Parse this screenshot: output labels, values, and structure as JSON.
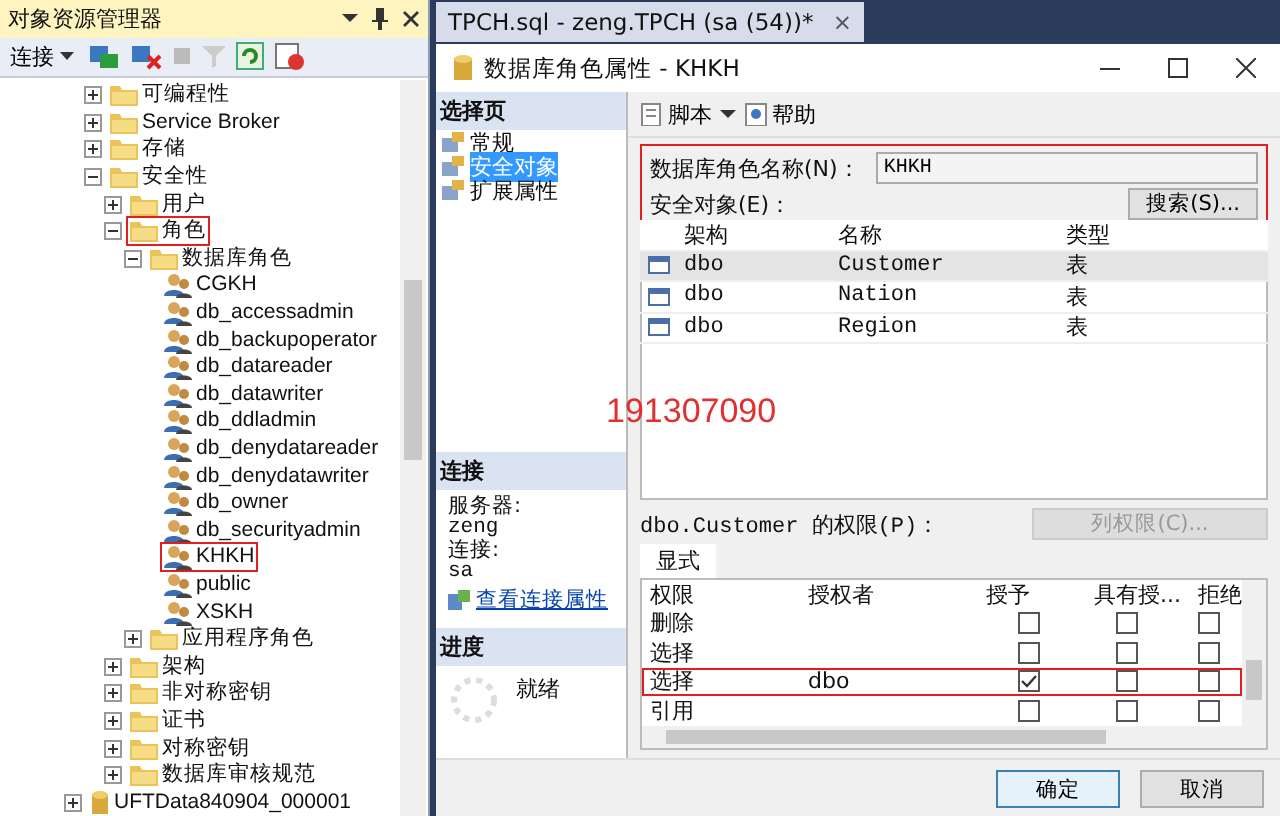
{
  "explorer": {
    "title": "对象资源管理器",
    "connect_label": "连接",
    "tree": [
      {
        "label": "可编程性",
        "kind": "folder",
        "expanded": false
      },
      {
        "label": "Service Broker",
        "kind": "folder",
        "expanded": false
      },
      {
        "label": "存储",
        "kind": "folder",
        "expanded": false
      },
      {
        "label": "安全性",
        "kind": "folder",
        "expanded": true,
        "children": [
          {
            "label": "用户",
            "kind": "folder",
            "expanded": false
          },
          {
            "label": "角色",
            "kind": "folder",
            "expanded": true,
            "marked": true,
            "children": [
              {
                "label": "数据库角色",
                "kind": "folder",
                "expanded": true,
                "children": [
                  {
                    "label": "CGKH",
                    "kind": "role"
                  },
                  {
                    "label": "db_accessadmin",
                    "kind": "role"
                  },
                  {
                    "label": "db_backupoperator",
                    "kind": "role"
                  },
                  {
                    "label": "db_datareader",
                    "kind": "role"
                  },
                  {
                    "label": "db_datawriter",
                    "kind": "role"
                  },
                  {
                    "label": "db_ddladmin",
                    "kind": "role"
                  },
                  {
                    "label": "db_denydatareader",
                    "kind": "role"
                  },
                  {
                    "label": "db_denydatawriter",
                    "kind": "role"
                  },
                  {
                    "label": "db_owner",
                    "kind": "role"
                  },
                  {
                    "label": "db_securityadmin",
                    "kind": "role"
                  },
                  {
                    "label": "KHKH",
                    "kind": "role",
                    "marked": true
                  },
                  {
                    "label": "public",
                    "kind": "role"
                  },
                  {
                    "label": "XSKH",
                    "kind": "role"
                  }
                ]
              },
              {
                "label": "应用程序角色",
                "kind": "folder",
                "expanded": false
              }
            ]
          },
          {
            "label": "架构",
            "kind": "folder",
            "expanded": false
          },
          {
            "label": "非对称密钥",
            "kind": "folder",
            "expanded": false
          },
          {
            "label": "证书",
            "kind": "folder",
            "expanded": false
          },
          {
            "label": "对称密钥",
            "kind": "folder",
            "expanded": false
          },
          {
            "label": "数据库审核规范",
            "kind": "folder",
            "expanded": false
          }
        ]
      }
    ],
    "databases": [
      {
        "label": "UFTData840904_000001",
        "kind": "database",
        "expanded": false
      }
    ]
  },
  "editor_tab": {
    "title": "TPCH.sql - zeng.TPCH (sa (54))*",
    "close": "×"
  },
  "dialog": {
    "title": "数据库角色属性 - KHKH",
    "select_page": {
      "header": "选择页",
      "items": [
        {
          "label": "常规",
          "selected": false
        },
        {
          "label": "安全对象",
          "selected": true
        },
        {
          "label": "扩展属性",
          "selected": false
        }
      ]
    },
    "connection": {
      "header": "连接",
      "server_label": "服务器:",
      "server": "zeng",
      "connection_label": "连接:",
      "connection": "sa",
      "link": "查看连接属性"
    },
    "progress": {
      "header": "进度",
      "status": "就绪"
    },
    "toolbar": {
      "script": "脚本",
      "help": "帮助"
    },
    "role_name_label": "数据库角色名称(N)：",
    "role_name": "KHKH",
    "securables_label": "安全对象(E)：",
    "search_button": "搜索(S)...",
    "securables_columns": [
      "架构",
      "名称",
      "类型"
    ],
    "securables": [
      {
        "schema": "dbo",
        "name": "Customer",
        "type": "表",
        "selected": true
      },
      {
        "schema": "dbo",
        "name": "Nation",
        "type": "表",
        "selected": false
      },
      {
        "schema": "dbo",
        "name": "Region",
        "type": "表",
        "selected": false
      }
    ],
    "permissions_label": "dbo.Customer 的权限(P)：",
    "column_permissions_button": {
      "label": "列权限(C)...",
      "disabled": true
    },
    "permissions_tab": "显式",
    "permission_columns": [
      "权限",
      "授权者",
      "授予",
      "具有授...",
      "拒绝"
    ],
    "permissions": [
      {
        "permission": "删除",
        "grant": false,
        "with_grant": false,
        "deny": false,
        "marked": false
      },
      {
        "permission": "选择",
        "grant": false,
        "with_grant": false,
        "deny": false,
        "marked": false
      },
      {
        "permission": "选择",
        "grantor": "dbo",
        "grant": true,
        "with_grant": false,
        "deny": false,
        "marked": true
      },
      {
        "permission": "引用",
        "grant": false,
        "with_grant": false,
        "deny": false,
        "marked": false
      }
    ],
    "buttons": [
      {
        "label": "确定",
        "default": true
      },
      {
        "label": "取消",
        "default": false
      }
    ]
  },
  "annotation": "191307090"
}
